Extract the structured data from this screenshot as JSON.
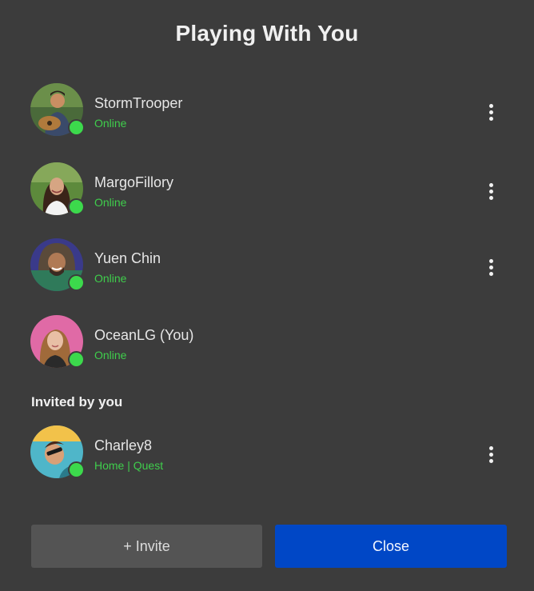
{
  "dialog": {
    "title": "Playing With You"
  },
  "players": [
    {
      "name": "StormTrooper",
      "status": "Online",
      "avatar_bg": "#4a6a3a",
      "has_menu": true
    },
    {
      "name": "MargoFillory",
      "status": "Online",
      "avatar_bg": "#5d8a3c",
      "has_menu": true
    },
    {
      "name": "Yuen Chin",
      "status": "Online",
      "avatar_bg": "#3a3a8a",
      "has_menu": true
    },
    {
      "name": "OceanLG (You)",
      "status": "Online",
      "avatar_bg": "#e06aa6",
      "has_menu": false
    }
  ],
  "invited_section": {
    "label": "Invited by you",
    "players": [
      {
        "name": "Charley8",
        "status": "Home | Quest",
        "avatar_bg": "#4fb6c9",
        "has_menu": true
      }
    ]
  },
  "buttons": {
    "invite_label": "+ Invite",
    "close_label": "Close"
  },
  "colors": {
    "background": "#3c3c3c",
    "online_green": "#3fce4c",
    "primary_blue": "#0047c6",
    "secondary_gray": "#545454"
  },
  "icons": {
    "more": "more-vertical-icon",
    "presence": "presence-dot-icon"
  }
}
